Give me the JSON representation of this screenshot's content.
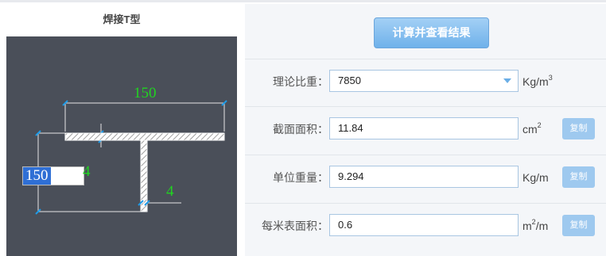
{
  "left_panel": {
    "title": "焊接T型",
    "diagram": {
      "flange_width": "150",
      "flange_thickness": "4",
      "web_thickness": "4",
      "editing_value": "150",
      "editing_dim": "4"
    }
  },
  "calculate_button": "计算并查看结果",
  "fields": [
    {
      "label": "理论比重：",
      "value": "7850",
      "unit_main": "Kg/m",
      "unit_sup": "3",
      "unit_tail": "",
      "copy": ""
    },
    {
      "label": "截面面积：",
      "value": "11.84",
      "unit_main": "cm",
      "unit_sup": "2",
      "unit_tail": "",
      "copy": "复制"
    },
    {
      "label": "单位重量：",
      "value": "9.294",
      "unit_main": "Kg/m",
      "unit_sup": "",
      "unit_tail": "",
      "copy": "复制"
    },
    {
      "label": "每米表面积：",
      "value": "0.6",
      "unit_main": "m",
      "unit_sup": "2",
      "unit_tail": "/m",
      "copy": "复制"
    }
  ],
  "colors": {
    "diagram_bg": "#4a4f59",
    "dimension_text": "#21d321",
    "dimension_line": "#e6e6e6",
    "tick": "#1e9be8",
    "button": "#6fb1ea"
  }
}
